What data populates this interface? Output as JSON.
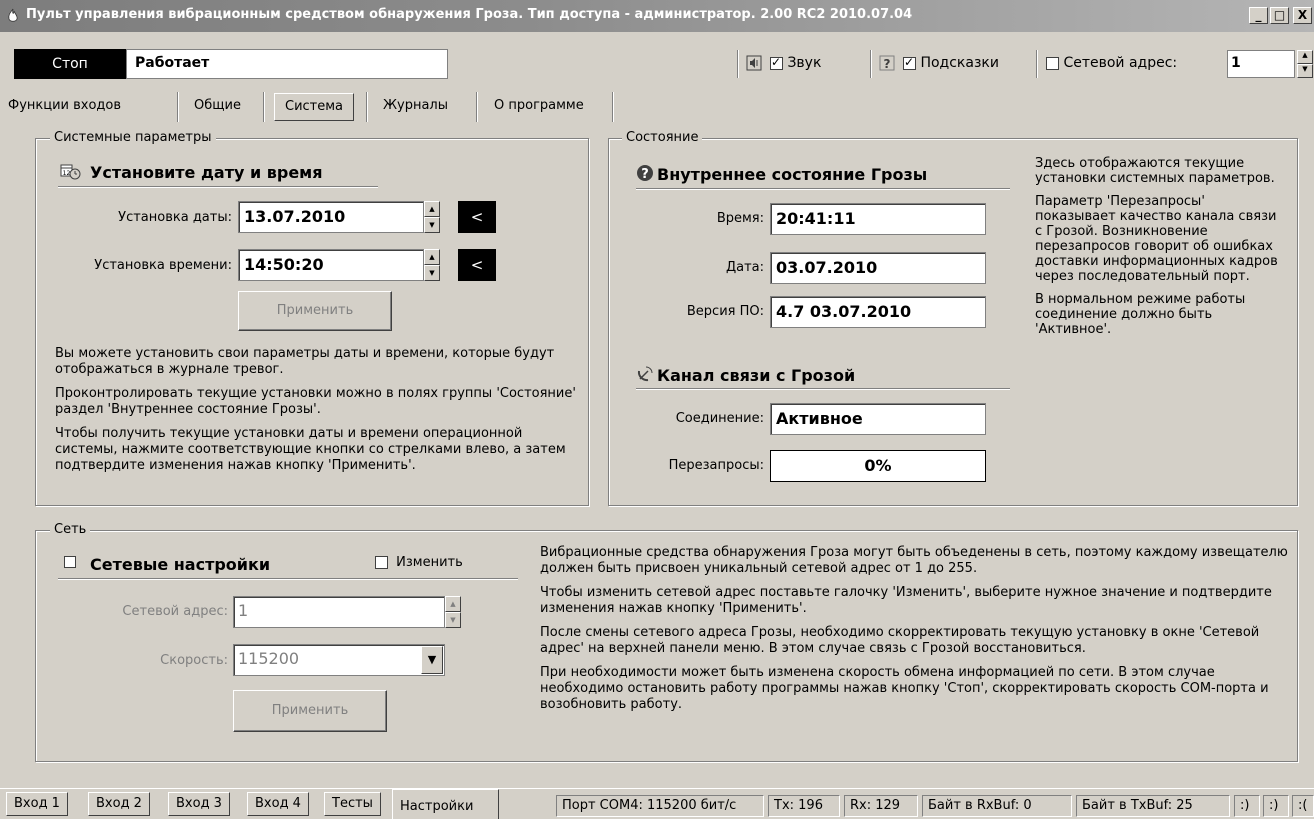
{
  "window": {
    "title": "Пульт управления вибрационным средством обнаружения Гроза. Тип доступа - администратор. 2.00 RC2 2010.07.04",
    "min_label": "_",
    "max_label": "□",
    "close_label": "X"
  },
  "toolbar": {
    "stop_label": "Стоп",
    "status_text": "Работает",
    "sound_label": "Звук",
    "sound_checked": true,
    "hints_label": "Подсказки",
    "hints_checked": true,
    "net_address_label": "Сетевой адрес:",
    "net_address_checked": false,
    "net_address_value": "1"
  },
  "tabs": [
    {
      "label": "Функции входов"
    },
    {
      "label": "Общие"
    },
    {
      "label": "Система",
      "active": true
    },
    {
      "label": "Журналы"
    },
    {
      "label": "О программе"
    }
  ],
  "system_params": {
    "legend": "Системные параметры",
    "title": "Установите дату и время",
    "date_label": "Установка даты:",
    "date_value": "13.07.2010",
    "time_label": "Установка времени:",
    "time_value": "14:50:20",
    "arrow_label": "<",
    "apply_label": "Применить",
    "help": [
      "Вы можете установить свои параметры даты и времени, которые будут отображаться в журнале тревог.",
      "Проконтролировать текущие установки можно в полях группы 'Состояние' раздел 'Внутреннее состояние Грозы'.",
      "Чтобы получить текущие установки даты и времени операционной системы, нажмите соответствующие кнопки со стрелками влево, а затем подтвердите изменения нажав кнопку 'Применить'."
    ]
  },
  "state": {
    "legend": "Состояние",
    "internal_title": "Внутреннее состояние Грозы",
    "time_label": "Время:",
    "time_value": "20:41:11",
    "date_label": "Дата:",
    "date_value": "03.07.2010",
    "version_label": "Версия ПО:",
    "version_value": "4.7 03.07.2010",
    "channel_title": "Канал связи с Грозой",
    "connection_label": "Соединение:",
    "connection_value": "Активное",
    "requeries_label": "Перезапросы:",
    "requeries_value": "0%",
    "help": [
      "Здесь отображаются текущие установки системных параметров.",
      "Параметр 'Перезапросы' показывает качество канала связи с Грозой. Возникновение перезапросов говорит об ошибках доставки информационных кадров через последовательный порт.",
      "В нормальном режиме работы соединение должно быть 'Активное'."
    ]
  },
  "network": {
    "legend": "Сеть",
    "title": "Сетевые настройки",
    "change_label": "Изменить",
    "change_checked": false,
    "address_label": "Сетевой адрес:",
    "address_value": "1",
    "speed_label": "Скорость:",
    "speed_value": "115200",
    "apply_label": "Применить",
    "help": [
      "Вибрационные средства обнаружения Гроза могут быть объеденены в сеть, поэтому каждому извещателю должен быть присвоен уникальный сетевой адрес от 1 до 255.",
      "Чтобы изменить сетевой адрес поставьте галочку 'Изменить', выберите нужное значение и подтвердите изменения нажав кнопку 'Применить'.",
      "После смены сетевого адреса Грозы, необходимо скорректировать текущую установку в окне 'Сетевой адрес' на верхней панели меню. В этом случае связь с Грозой восстановиться.",
      "При необходимости может быть изменена скорость обмена информацией по сети. В этом случае необходимо остановить работу программы нажав кнопку 'Стоп', скорректировать скорость COM-порта и возобновить работу."
    ]
  },
  "bottom_tabs": [
    {
      "label": "Вход 1"
    },
    {
      "label": "Вход 2"
    },
    {
      "label": "Вход 3"
    },
    {
      "label": "Вход 4"
    },
    {
      "label": "Тесты"
    },
    {
      "label": "Настройки",
      "active": true
    }
  ],
  "statusbar": {
    "port": "Порт COM4: 115200 бит/с",
    "tx": "Tx: 196",
    "rx": "Rx: 129",
    "rxbuf": "Байт в RxBuf: 0",
    "txbuf": "Байт в TxBuf: 25",
    "smiley1": ":)",
    "smiley2": ":)",
    "smiley3": ":("
  },
  "icons": {
    "app": "flame-icon",
    "sound": "speaker-icon",
    "hints": "help-icon",
    "calendar": "calendar-clock-icon",
    "internal_state": "question-circle-icon",
    "channel": "satellite-dish-icon",
    "net_checkbox": "checkbox-icon"
  }
}
